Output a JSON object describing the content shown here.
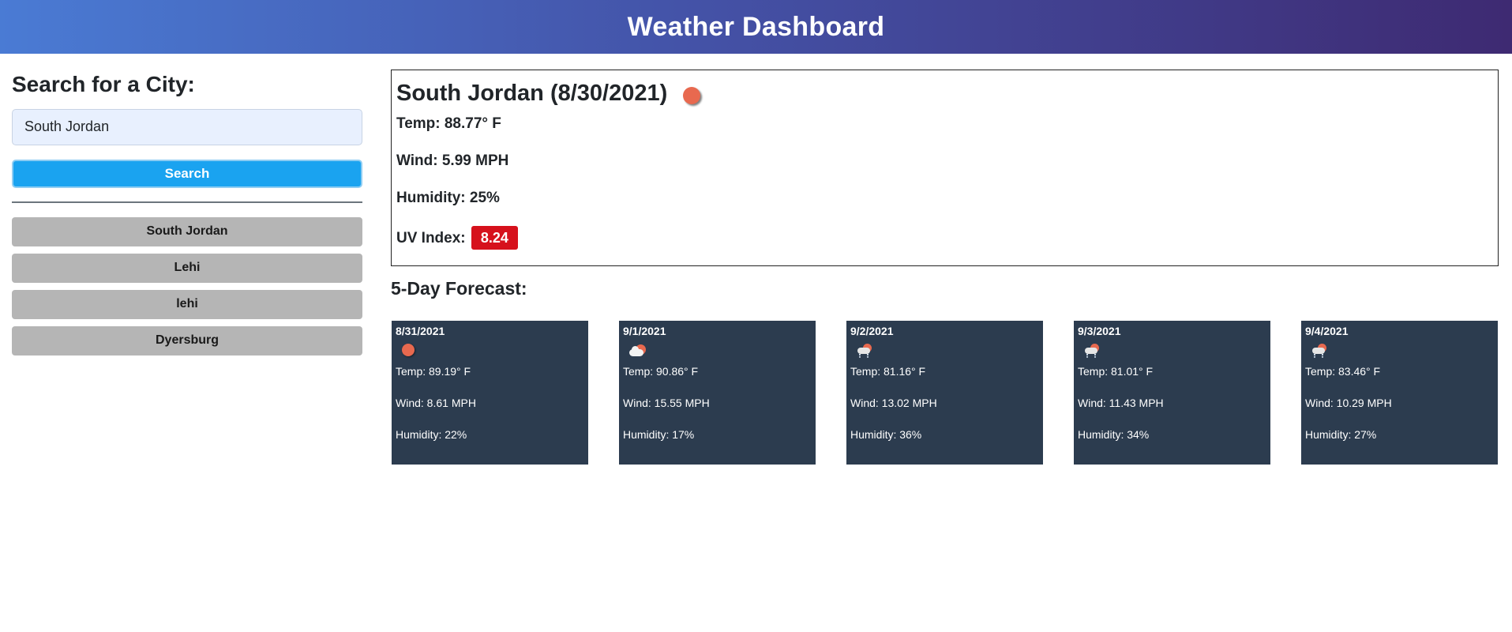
{
  "header": {
    "title": "Weather Dashboard"
  },
  "search": {
    "heading": "Search for a City:",
    "input_value": "South Jordan",
    "button_label": "Search"
  },
  "history": [
    {
      "label": "South Jordan"
    },
    {
      "label": "Lehi"
    },
    {
      "label": "lehi"
    },
    {
      "label": "Dyersburg"
    }
  ],
  "current": {
    "title": "South Jordan (8/30/2021)",
    "icon": "sun-icon",
    "temp": "Temp: 88.77° F",
    "wind": "Wind: 5.99 MPH",
    "humidity": "Humidity: 25%",
    "uv_label": "UV Index:",
    "uv_value": "8.24",
    "uv_color": "#d6111c"
  },
  "forecast": {
    "title": "5-Day Forecast:",
    "days": [
      {
        "date": "8/31/2021",
        "icon": "sun-icon",
        "temp": "Temp: 89.19° F",
        "wind": "Wind: 8.61 MPH",
        "humidity": "Humidity: 22%"
      },
      {
        "date": "9/1/2021",
        "icon": "partly-cloudy-icon",
        "temp": "Temp: 90.86° F",
        "wind": "Wind: 15.55 MPH",
        "humidity": "Humidity: 17%"
      },
      {
        "date": "9/2/2021",
        "icon": "rain-icon",
        "temp": "Temp: 81.16° F",
        "wind": "Wind: 13.02 MPH",
        "humidity": "Humidity: 36%"
      },
      {
        "date": "9/3/2021",
        "icon": "rain-icon",
        "temp": "Temp: 81.01° F",
        "wind": "Wind: 11.43 MPH",
        "humidity": "Humidity: 34%"
      },
      {
        "date": "9/4/2021",
        "icon": "rain-icon",
        "temp": "Temp: 83.46° F",
        "wind": "Wind: 10.29 MPH",
        "humidity": "Humidity: 27%"
      }
    ]
  },
  "colors": {
    "search_button": "#1aa3f0",
    "history_button": "#b5b5b5",
    "forecast_card": "#2c3c4f"
  }
}
